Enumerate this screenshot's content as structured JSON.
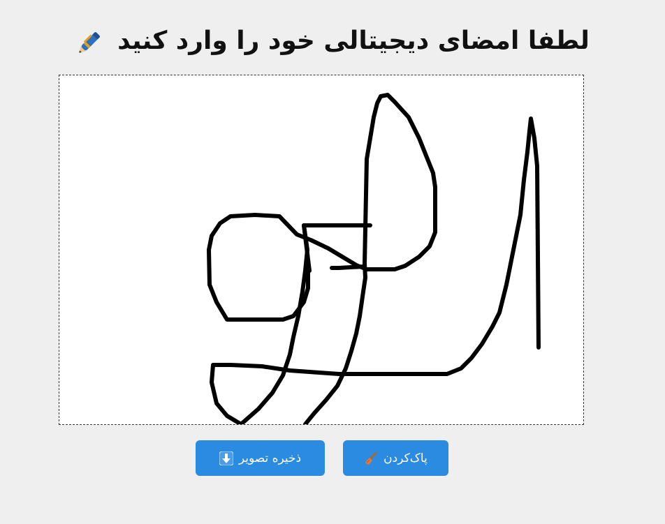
{
  "header": {
    "title": "لطفا امضای دیجیتالی خود را وارد کنید",
    "icon": "pen-icon"
  },
  "signature_pad": {
    "icon": "signature-stroke",
    "background_color": "#ffffff",
    "stroke_color": "#000000"
  },
  "actions": {
    "save_label": "ذخیره تصویر",
    "save_icon": "download-arrow-icon",
    "clear_label": "پاک‌کردن",
    "clear_icon": "broom-icon",
    "button_color": "#2b8be0"
  }
}
